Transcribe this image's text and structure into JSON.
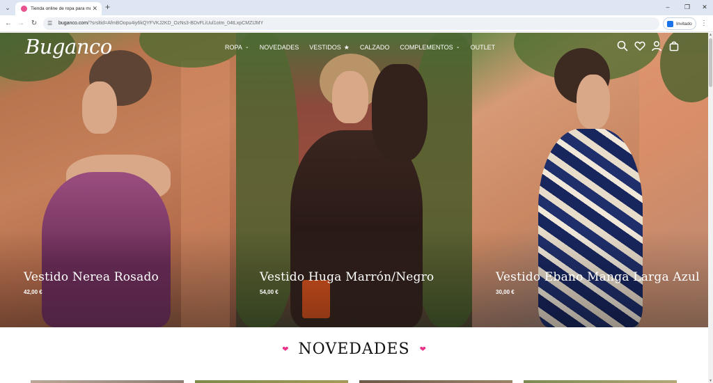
{
  "browser": {
    "tab_menu_icon": "chevron-down-icon",
    "tab_title": "Tienda online de ropa para mu",
    "new_tab_label": "+",
    "url_domain": "buganco.com",
    "url_path": "/?srsltid=AfmBOopu4iy6kQYFVKJ2KD_OzNs3-BDvFLiUul1otm_04tLxpCMZIJMY",
    "profile_label": "Invitado",
    "window_controls": [
      "minimize-icon",
      "restore-icon",
      "close-icon"
    ]
  },
  "site": {
    "logo": "Buganco",
    "nav": [
      {
        "label": "ROPA",
        "indicator": "chevron"
      },
      {
        "label": "NOVEDADES",
        "indicator": ""
      },
      {
        "label": "VESTIDOS",
        "indicator": "star"
      },
      {
        "label": "CALZADO",
        "indicator": ""
      },
      {
        "label": "COMPLEMENTOS",
        "indicator": "chevron"
      },
      {
        "label": "OUTLET",
        "indicator": ""
      }
    ],
    "header_icons": [
      "search-icon",
      "wishlist-heart-icon",
      "account-icon",
      "cart-bag-icon"
    ]
  },
  "hero": [
    {
      "title": "Vestido Nerea Rosado",
      "price": "42,00 €"
    },
    {
      "title": "Vestido Huga Marrón/Negro",
      "price": "54,00 €"
    },
    {
      "title": "Vestido Ebano Manga Larga Azul",
      "price": "30,00 €"
    }
  ],
  "section": {
    "title": "NOVEDADES",
    "decoration_icon": "heart-icon",
    "accent_color": "#e8328a"
  }
}
